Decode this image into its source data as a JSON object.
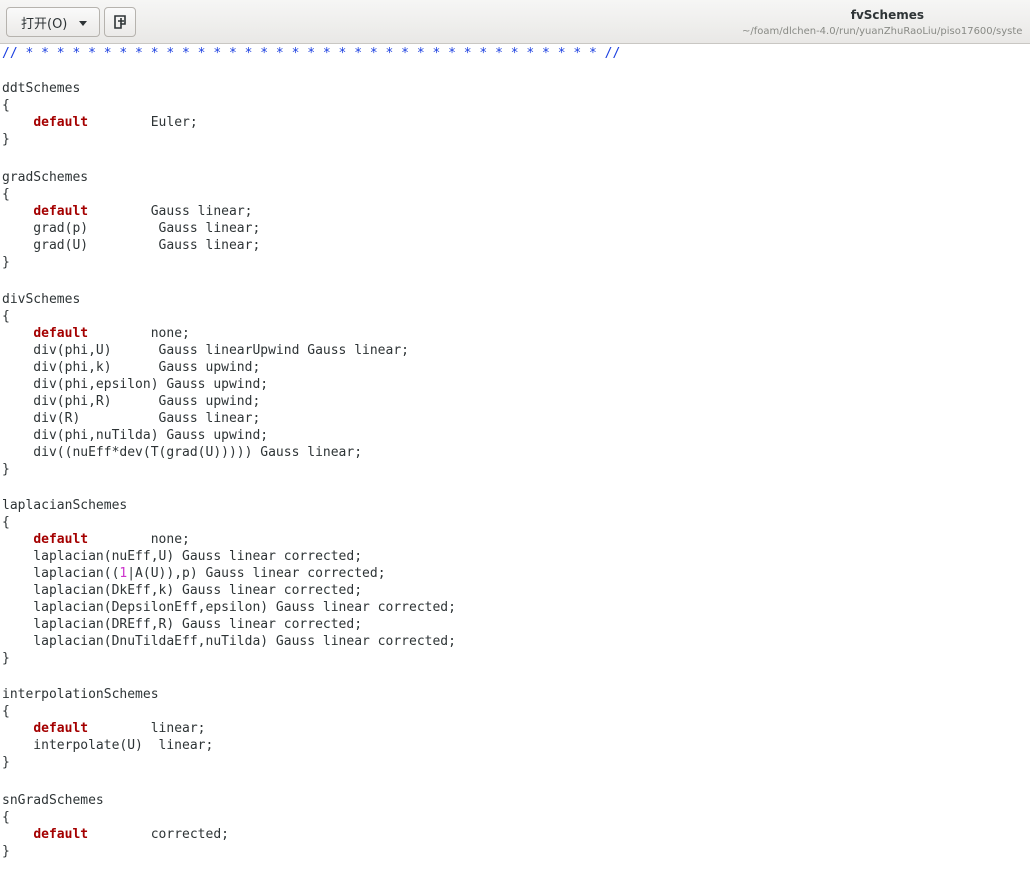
{
  "window": {
    "open_button_label": "打开(O)",
    "title": "fvSchemes",
    "path": "~/foam/dlchen-4.0/run/yuanZhuRaoLiu/piso17600/syste"
  },
  "code": {
    "comment": "// * * * * * * * * * * * * * * * * * * * * * * * * * * * * * * * * * * * * * //",
    "ddt_header": "ddtSchemes",
    "ddt_open": "{",
    "ddt_default_kw": "default",
    "ddt_default_val": "        Euler;",
    "ddt_close": "}",
    "grad_header": "gradSchemes",
    "grad_open": "{",
    "grad_default_kw": "default",
    "grad_default_val": "        Gauss linear;",
    "grad_p": "    grad(p)         Gauss linear;",
    "grad_U": "    grad(U)         Gauss linear;",
    "grad_close": "}",
    "div_header": "divSchemes",
    "div_open": "{",
    "div_default_kw": "default",
    "div_default_val": "        none;",
    "div_phi_U": "    div(phi,U)      Gauss linearUpwind Gauss linear;",
    "div_phi_k": "    div(phi,k)      Gauss upwind;",
    "div_phi_epsilon": "    div(phi,epsilon) Gauss upwind;",
    "div_phi_R": "    div(phi,R)      Gauss upwind;",
    "div_R": "    div(R)          Gauss linear;",
    "div_phi_nuTilda": "    div(phi,nuTilda) Gauss upwind;",
    "div_nuEff": "    div((nuEff*dev(T(grad(U))))) Gauss linear;",
    "div_close": "}",
    "lap_header": "laplacianSchemes",
    "lap_open": "{",
    "lap_default_kw": "default",
    "lap_default_val": "        none;",
    "lap_nuEff_U": "    laplacian(nuEff,U) Gauss linear corrected;",
    "lap_A_pre": "    laplacian((",
    "lap_A_num": "1",
    "lap_A_post": "|A(U)),p) Gauss linear corrected;",
    "lap_DkEff": "    laplacian(DkEff,k) Gauss linear corrected;",
    "lap_DepsilonEff": "    laplacian(DepsilonEff,epsilon) Gauss linear corrected;",
    "lap_DREff": "    laplacian(DREff,R) Gauss linear corrected;",
    "lap_DnuTildaEff": "    laplacian(DnuTildaEff,nuTilda) Gauss linear corrected;",
    "lap_close": "}",
    "interp_header": "interpolationSchemes",
    "interp_open": "{",
    "interp_default_kw": "default",
    "interp_default_val": "        linear;",
    "interp_U": "    interpolate(U)  linear;",
    "interp_close": "}",
    "sngrad_header": "snGradSchemes",
    "sngrad_open": "{",
    "sngrad_default_kw": "default",
    "sngrad_default_val": "        corrected;",
    "sngrad_close": "}"
  }
}
